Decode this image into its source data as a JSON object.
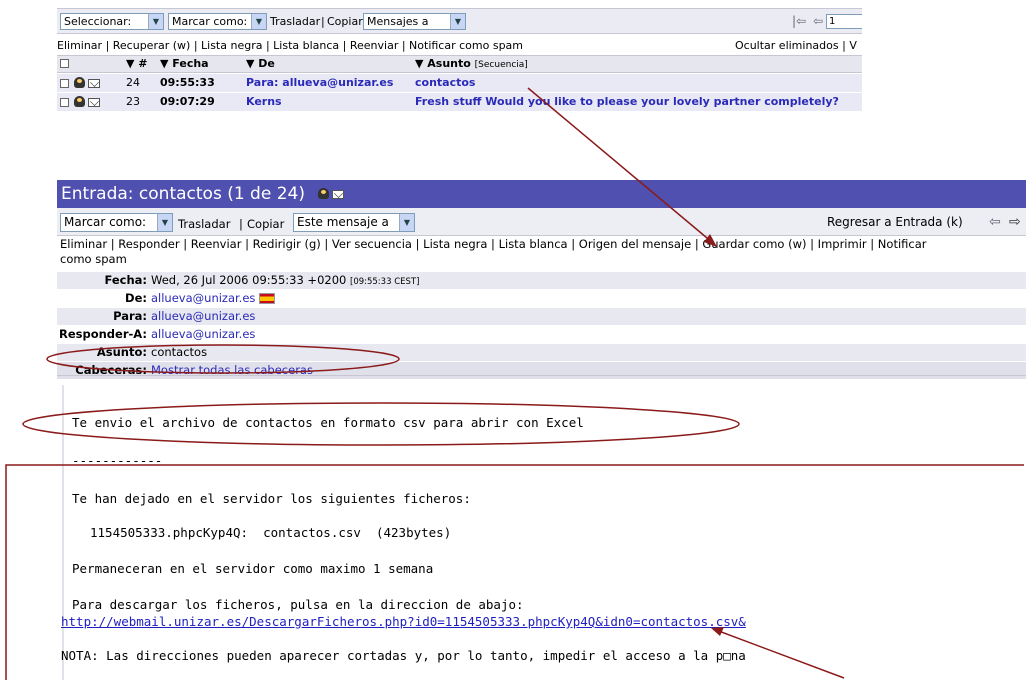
{
  "list": {
    "select_label": "Seleccionar:",
    "mark_label": "Marcar como:",
    "move_label": "Trasladar",
    "copy_label": "Copiar",
    "folder_value": "Mensajes a",
    "page_value": "1",
    "actions": "Eliminar | Recuperar (w) | Lista negra | Lista blanca | Reenviar | Notificar como spam",
    "hide_deleted": "Ocultar eliminados | V",
    "columns": {
      "num": "▼ #",
      "date": "▼ Fecha",
      "from": "▼ De",
      "subject": "▼ Asunto",
      "subject_extra": "[Secuencia]"
    },
    "rows": [
      {
        "num": "24",
        "time": "09:55:33",
        "from": "Para: allueva@unizar.es",
        "subject": "contactos"
      },
      {
        "num": "23",
        "time": "09:07:29",
        "from": "Kerns",
        "subject": "Fresh stuff Would you like to please your lovely partner completely?"
      }
    ]
  },
  "view": {
    "title": "Entrada: contactos (1 de 24)",
    "mark_label": "Marcar como:",
    "move_label": "Trasladar",
    "copy_label": "Copiar",
    "this_msg_value": "Este mensaje a",
    "back_label": "Regresar a Entrada (k)",
    "actions_line1": "Eliminar | Responder | Reenviar | Redirigir (g) | Ver secuencia | Lista negra | Lista blanca | Origen del mensaje | Guardar como (w) | Imprimir | Notificar",
    "actions_line2": "como spam",
    "headers": {
      "date_label": "Fecha:",
      "date_value": "Wed, 26 Jul 2006 09:55:33 +0200",
      "date_extra": "[09:55:33 CEST]",
      "from_label": "De:",
      "from_value": "allueva@unizar.es",
      "to_label": "Para:",
      "to_value": "allueva@unizar.es",
      "reply_label": "Responder-A:",
      "reply_value": "allueva@unizar.es",
      "subject_label": "Asunto:",
      "subject_value": "contactos",
      "headers_label": "Cabeceras:",
      "headers_value": "Mostrar todas las cabeceras"
    },
    "body": {
      "line1": "Te envio el archivo de contactos en formato csv para abrir con Excel",
      "separator": "------------",
      "line2": "Te han dejado en el servidor los siguientes ficheros:",
      "line3": "1154505333.phpcKyp4Q:  contactos.csv  (423bytes)",
      "line4": "Permaneceran en el servidor como maximo 1 semana",
      "line5": "Para descargar los ficheros, pulsa en la direccion de abajo:",
      "link": "http://webmail.unizar.es/DescargarFicheros.php?id0=1154505333.phpcKyp4Q&idn0=contactos.csv&",
      "note": "NOTA: Las direcciones pueden aparecer cortadas y, por lo tanto, impedir el acceso a la p□na"
    }
  },
  "colors": {
    "title_bar": "#5050b0",
    "annotation": "#8b1a1a",
    "link": "#2a2ab8"
  }
}
